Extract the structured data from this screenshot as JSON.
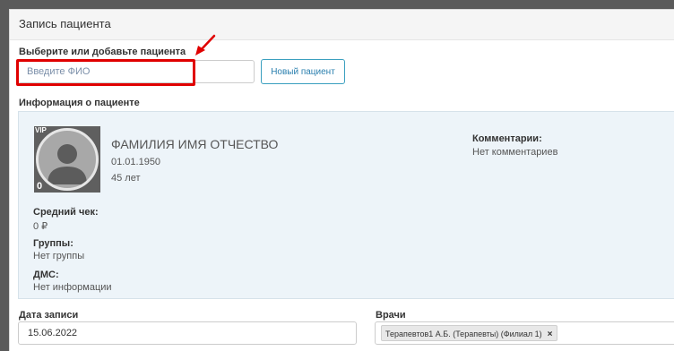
{
  "modal": {
    "title": "Запись пациента"
  },
  "search": {
    "label": "Выберите или добавьте пациента",
    "placeholder": "Введите ФИО",
    "value": "",
    "new_patient_label": "Новый пациент"
  },
  "patient_info": {
    "section_label": "Информация о пациенте",
    "vip_label": "VIP",
    "badge_count": "0",
    "name": "ФАМИЛИЯ ИМЯ ОТЧЕСТВО",
    "birth_date": "01.01.1950",
    "age": "45 лет",
    "comments_label": "Комментарии:",
    "comments_value": "Нет комментариев",
    "average_check_label": "Средний чек:",
    "average_check_value": "0 ₽",
    "groups_label": "Группы:",
    "groups_value": "Нет группы",
    "dms_label": "ДМС:",
    "dms_value": "Нет информации"
  },
  "appointment": {
    "date_label": "Дата записи",
    "date_value": "15.06.2022",
    "doctors_label": "Врачи",
    "doctors": [
      {
        "label": "Терапевтов1 А.Б. (Терапевты) (Филиал 1)",
        "remove": "×"
      }
    ]
  },
  "colors": {
    "highlight": "#e00000",
    "accent": "#2a7fae",
    "panel_bg": "#edf4f9",
    "backdrop": "#5a5a5a"
  }
}
